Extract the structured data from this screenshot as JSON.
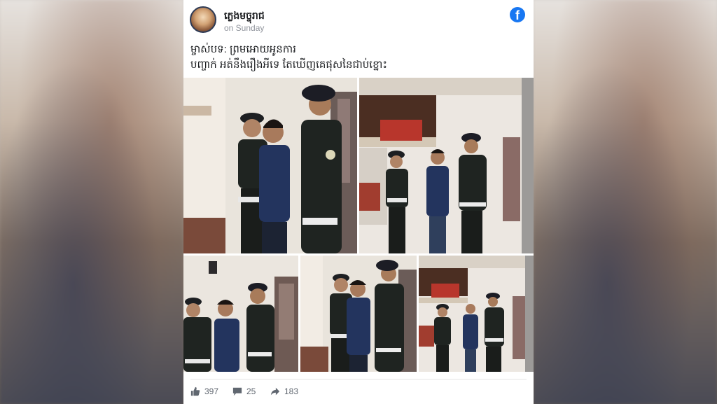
{
  "post": {
    "author": "ភ្លេងមច្ចុរាជ",
    "time": "on Sunday",
    "text_line1": "ម្ចាស់បទ: ព្រមអោយអូនការ",
    "text_line2": "បញ្ចាក់ អត់នឹងរឿងអីទេ តែឃើញគេផុសនៃជាប់ខ្នោះ"
  },
  "icons": {
    "logo": "facebook-logo-icon",
    "like": "thumbs-up-icon",
    "comment": "comment-icon",
    "share": "share-arrow-icon"
  },
  "stats": {
    "likes": "397",
    "comments": "25",
    "shares": "183"
  },
  "colors": {
    "facebook_blue": "#1877f2",
    "uniform": "#1f2421",
    "shirt": "#23345e"
  }
}
